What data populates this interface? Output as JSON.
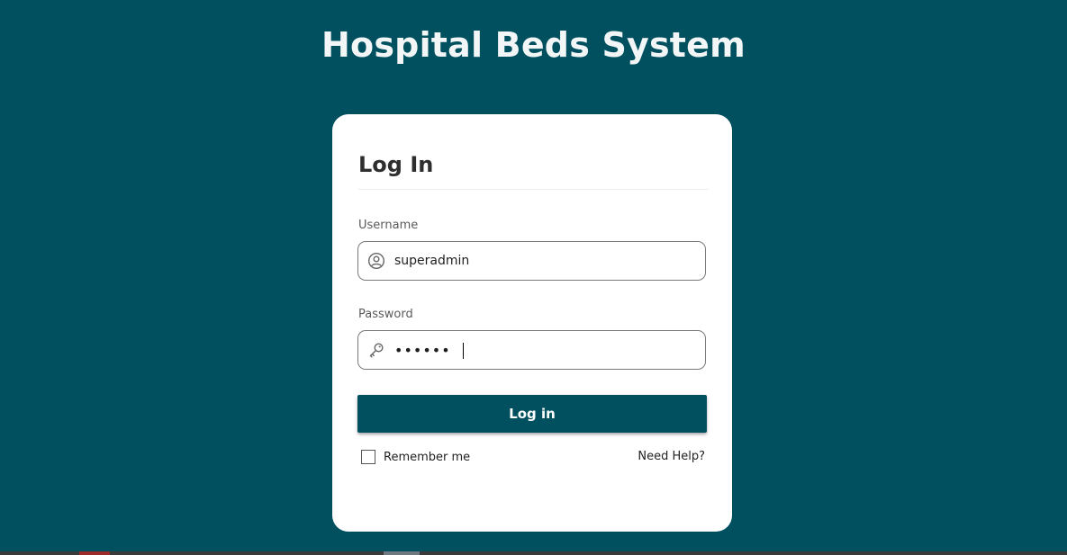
{
  "app": {
    "title": "Hospital Beds System"
  },
  "login_card": {
    "title": "Log In",
    "username": {
      "label": "Username",
      "value": "superadmin",
      "icon": "user-circle-icon"
    },
    "password": {
      "label": "Password",
      "value": "••••••",
      "icon": "key-icon"
    },
    "submit_label": "Log in",
    "remember_label": "Remember me",
    "remember_checked": false,
    "help_label": "Need Help?"
  },
  "colors": {
    "background": "#00505f",
    "button": "#00505f",
    "card": "#ffffff"
  }
}
